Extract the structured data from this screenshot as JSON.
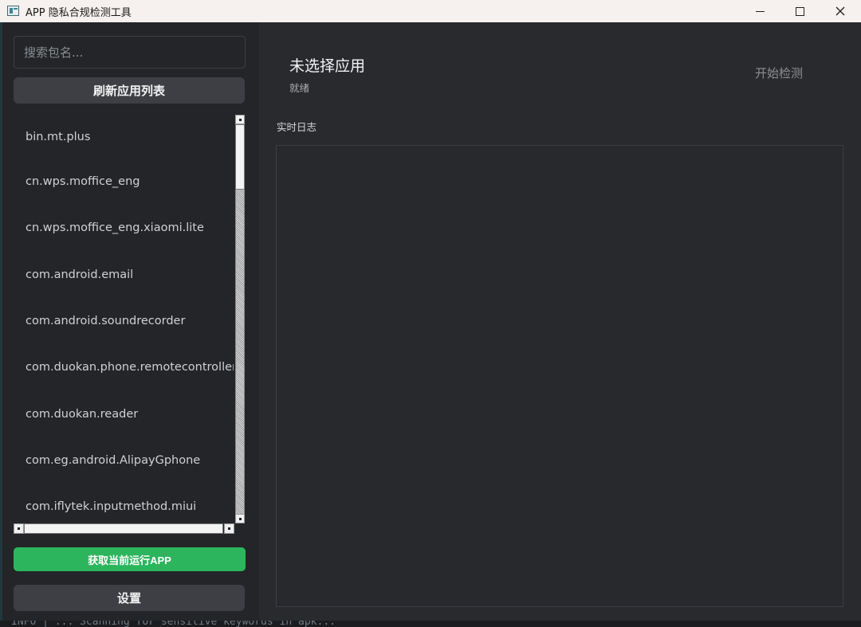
{
  "window": {
    "title": "APP 隐私合规检测工具",
    "icon": "app-window-icon"
  },
  "sidebar": {
    "search_placeholder": "搜索包名...",
    "search_value": "",
    "refresh_label": "刷新应用列表",
    "packages": [
      "bin.mt.plus",
      "cn.wps.moffice_eng",
      "cn.wps.moffice_eng.xiaomi.lite",
      "com.android.email",
      "com.android.soundrecorder",
      "com.duokan.phone.remotecontroller",
      "com.duokan.reader",
      "com.eg.android.AlipayGphone",
      "com.iflytek.inputmethod.miui"
    ],
    "running_app_label": "获取当前运行APP",
    "settings_label": "设置"
  },
  "main": {
    "selected_app": "未选择应用",
    "status": "就绪",
    "start_label": "开始检测",
    "log_label": "实时日志",
    "log_content": ""
  },
  "background": {
    "partial_text": "INFO  |  ...  Scanning for sensitive keywords in apk..."
  },
  "colors": {
    "sidebar_bg": "#232528",
    "main_bg": "#282a2e",
    "button_gray": "#3d3f44",
    "accent_green": "#2db55d",
    "titlebar_bg": "#f6f1ee"
  }
}
